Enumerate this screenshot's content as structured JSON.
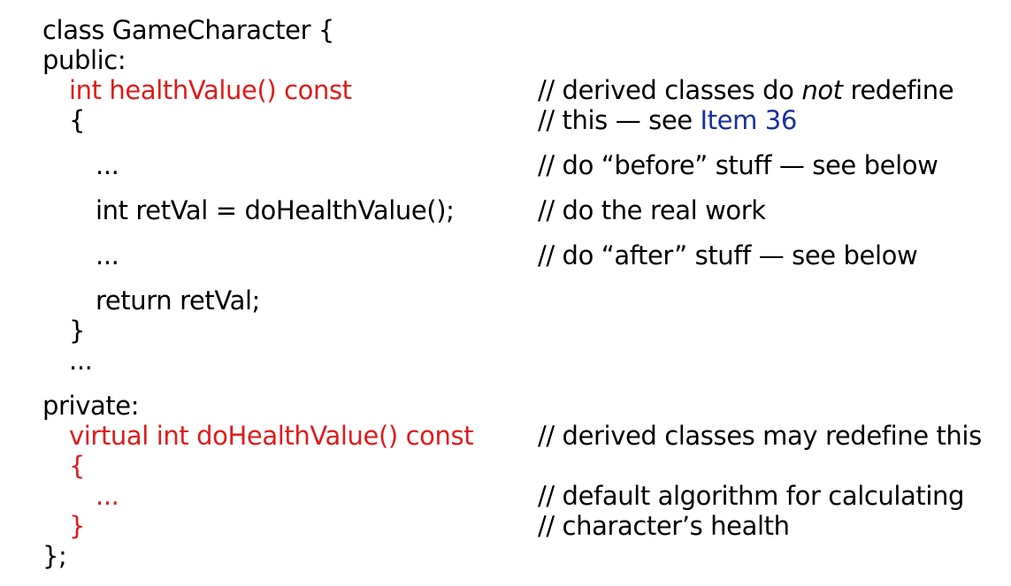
{
  "code": {
    "class_decl": "class GameCharacter {",
    "public_label": "public:",
    "health_value_sig": "int healthValue() const",
    "open_brace_1": "{",
    "ellipsis_before": "...",
    "retval_stmt": "int retVal = doHealthValue();",
    "ellipsis_after": "...",
    "return_stmt": "return retVal;",
    "close_brace_1": "}",
    "ellipsis_members": "...",
    "private_label": "private:",
    "do_health_value_sig": "virtual int doHealthValue() const",
    "open_brace_2": "{",
    "ellipsis_default": "...",
    "close_brace_2": "}",
    "class_end": "};"
  },
  "comments": {
    "derived_prefix": "// derived classes do ",
    "derived_emphasis": "not",
    "derived_suffix": " redefine",
    "this_prefix": "// this — see ",
    "item_link": "Item 36",
    "before": "// do “before” stuff — see below",
    "real_work": "// do the real work",
    "after": "// do “after” stuff — see below",
    "may_redefine": "// derived classes may redefine this",
    "default_algo": "// default algorithm for calculating",
    "char_health": "// character’s health"
  },
  "colors": {
    "text": "#000000",
    "highlight": "#e11b1b",
    "link": "#1c2f9c",
    "background": "#ffffff"
  }
}
